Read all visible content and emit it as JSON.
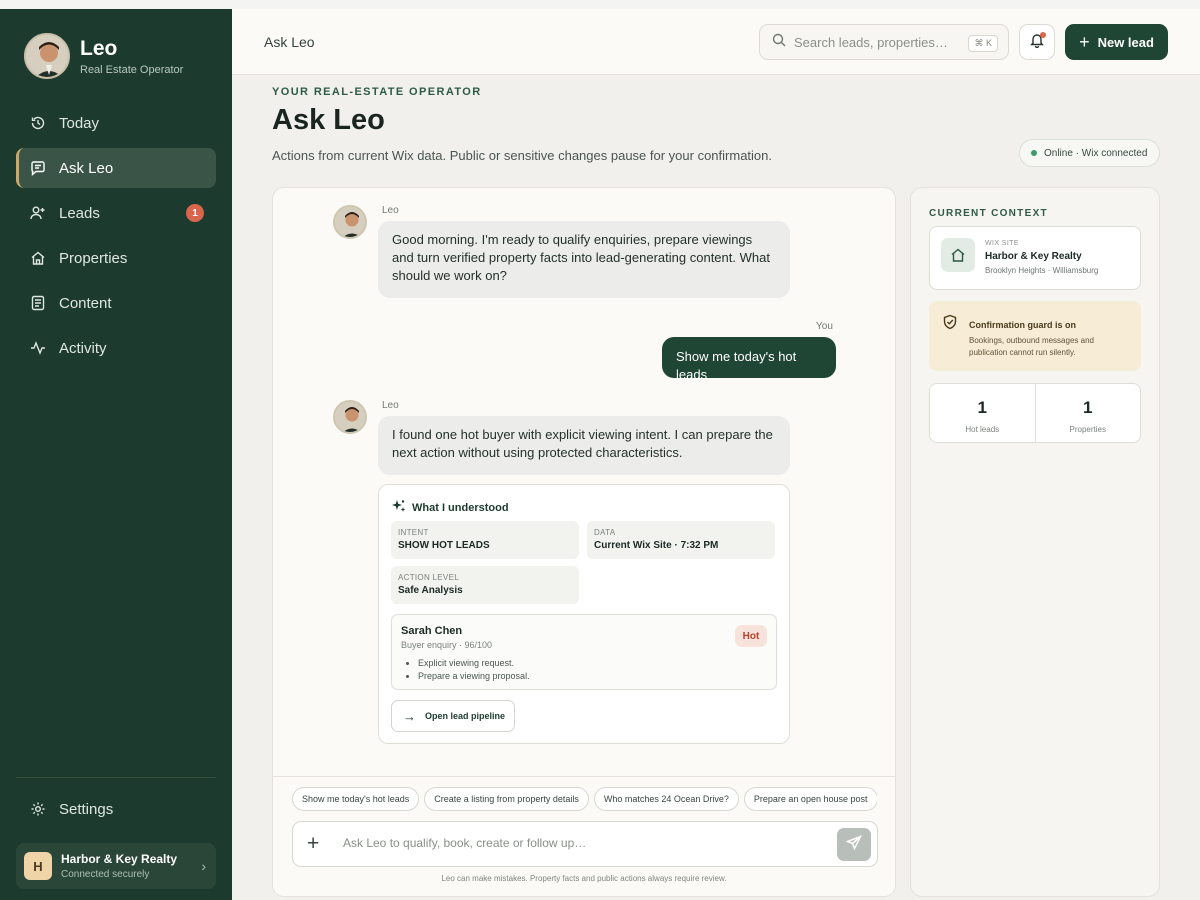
{
  "brand": {
    "name": "Leo",
    "subtitle": "Real Estate Operator"
  },
  "nav": [
    {
      "label": "Today",
      "icon": "history-icon"
    },
    {
      "label": "Ask Leo",
      "icon": "chat-icon",
      "active": true
    },
    {
      "label": "Leads",
      "icon": "user-plus-icon",
      "badge": "1"
    },
    {
      "label": "Properties",
      "icon": "home-icon"
    },
    {
      "label": "Content",
      "icon": "document-icon"
    },
    {
      "label": "Activity",
      "icon": "activity-icon"
    }
  ],
  "settings_label": "Settings",
  "workspace": {
    "initial": "H",
    "name": "Harbor & Key Realty",
    "status": "Connected securely"
  },
  "header": {
    "breadcrumb": "Ask Leo",
    "search_placeholder": "Search leads, properties…",
    "shortcut": "⌘ K",
    "new_lead_label": "New lead"
  },
  "page": {
    "eyebrow": "YOUR REAL-ESTATE OPERATOR",
    "title": "Ask Leo",
    "subtitle": "Actions from current Wix data. Public or sensitive changes pause for your confirmation.",
    "status": "Online · Wix connected"
  },
  "chat": {
    "messages": [
      {
        "sender": "Leo",
        "text": "Good morning. I'm ready to qualify enquiries, prepare viewings and turn verified property facts into lead-generating content. What should we work on?"
      },
      {
        "sender": "You",
        "text": "Show me today's hot leads"
      },
      {
        "sender": "Leo",
        "text": "I found one hot buyer with explicit viewing intent. I can prepare the next action without using protected characteristics."
      }
    ],
    "card": {
      "title": "What I understood",
      "fields": [
        {
          "label": "Intent",
          "value": "SHOW HOT LEADS"
        },
        {
          "label": "Data",
          "value": "Current Wix Site · 7:32 PM"
        },
        {
          "label": "Action Level",
          "value": "Safe Analysis"
        }
      ],
      "lead": {
        "name": "Sarah Chen",
        "meta": "Buyer enquiry · 96/100",
        "tag": "Hot",
        "bullets": [
          "Explicit viewing request.",
          "Prepare a viewing proposal."
        ]
      },
      "action_label": "Open lead pipeline"
    },
    "chips": [
      "Show me today's hot leads",
      "Create a listing from property details",
      "Who matches 24 Ocean Drive?",
      "Prepare an open house post"
    ],
    "input_placeholder": "Ask Leo to qualify, book, create or follow up…",
    "disclaimer": "Leo can make mistakes. Property facts and public actions always require review."
  },
  "context": {
    "title": "CURRENT CONTEXT",
    "site": {
      "label": "WIX SITE",
      "name": "Harbor & Key Realty",
      "location": "Brooklyn Heights · Williamsburg"
    },
    "guard": {
      "title": "Confirmation guard is on",
      "text": "Bookings, outbound messages and publication cannot run silently."
    },
    "stats": [
      {
        "value": "1",
        "label": "Hot leads"
      },
      {
        "value": "1",
        "label": "Properties"
      }
    ]
  },
  "colors": {
    "sidebar": "#1c3a2e",
    "accent": "#1f4535",
    "hot": "#b5402b",
    "guard": "#f7ecd6"
  }
}
